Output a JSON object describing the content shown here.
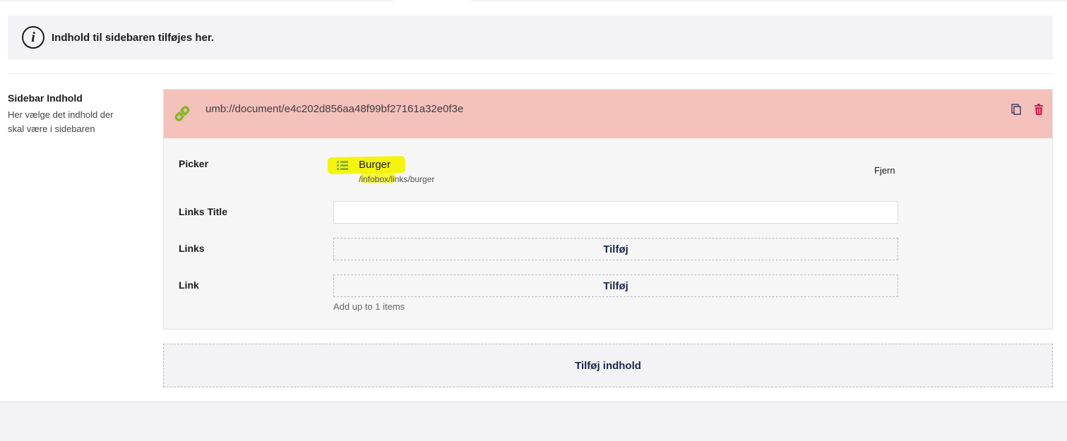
{
  "info": {
    "icon": "info-icon",
    "text": "Indhold til sidebaren tilføjes her."
  },
  "property": {
    "name": "Sidebar Indhold",
    "description": "Her vælge det indhold der skal være i sidebaren"
  },
  "block": {
    "header_color": "#f4c1bb",
    "header_icon": "link-icon",
    "header_icon_color": "#88b52a",
    "title": "umb://document/e4c202d856aa48f99bf27161a32e0f3e",
    "actions": [
      {
        "icon": "copy-icon"
      },
      {
        "icon": "trash-icon",
        "color": "#d42054"
      }
    ],
    "fields": {
      "picker": {
        "label": "Picker",
        "item_icon": "list-icon",
        "item_name": "Burger",
        "item_path": "/infobox/links/burger",
        "remove_label": "Fjern",
        "highlight_color": "#f4f40f"
      },
      "links_title": {
        "label": "Links Title",
        "value": ""
      },
      "links": {
        "label": "Links",
        "add_label": "Tilføj"
      },
      "link": {
        "label": "Link",
        "add_label": "Tilføj",
        "hint": "Add up to 1 items"
      }
    }
  },
  "add_content_label": "Tilføj indhold"
}
